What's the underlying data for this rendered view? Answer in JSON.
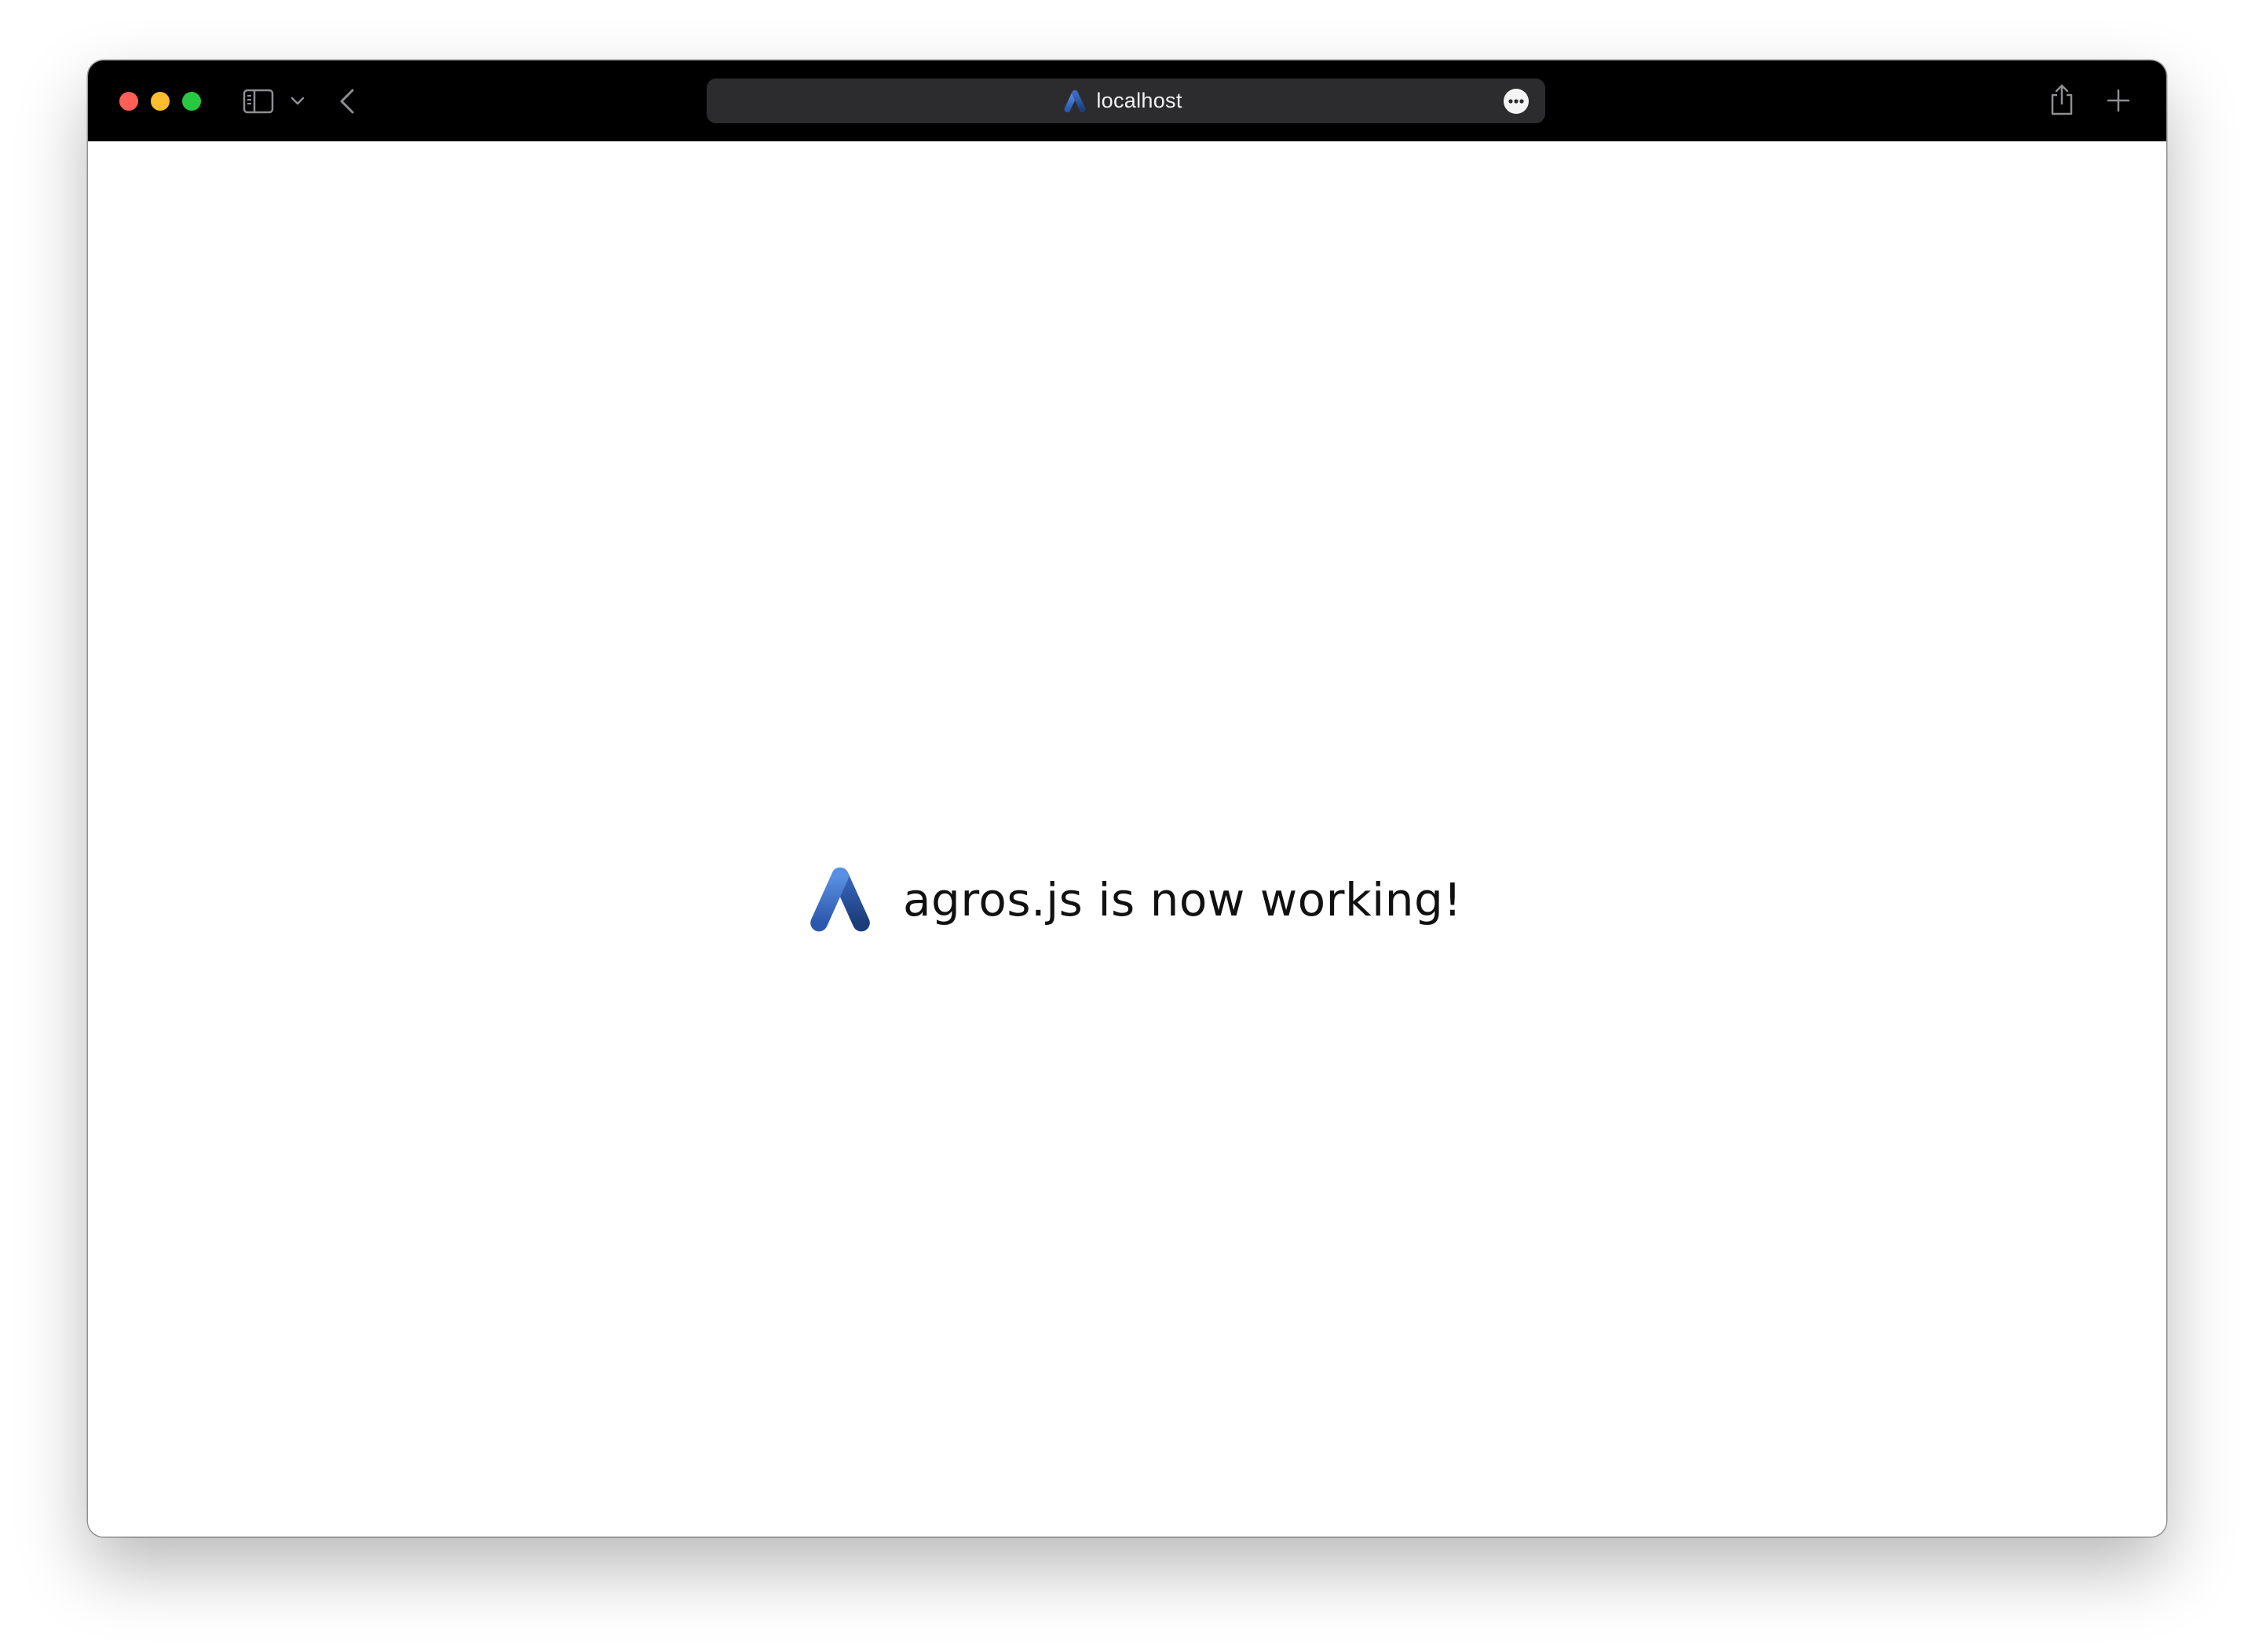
{
  "browser": {
    "address_bar": {
      "url": "localhost"
    },
    "traffic_lights": {
      "close_color": "#ff5f57",
      "minimize_color": "#febc2e",
      "zoom_color": "#28c840"
    },
    "icons": {
      "sidebar": "sidebar-icon",
      "chevron": "chevron-down-icon",
      "back": "back-arrow-icon",
      "favicon": "agros-logo-icon",
      "more": "ellipsis-circle-icon",
      "share": "share-icon",
      "new_tab": "plus-icon"
    }
  },
  "page": {
    "headline": "agros.js is now working!",
    "logo": "agros-logo-icon"
  },
  "colors": {
    "toolbar_bg": "#000000",
    "address_bg": "#2c2c2e",
    "logo_light": "#4a7fd6",
    "logo_dark": "#1d3f7a",
    "text": "#111111"
  }
}
